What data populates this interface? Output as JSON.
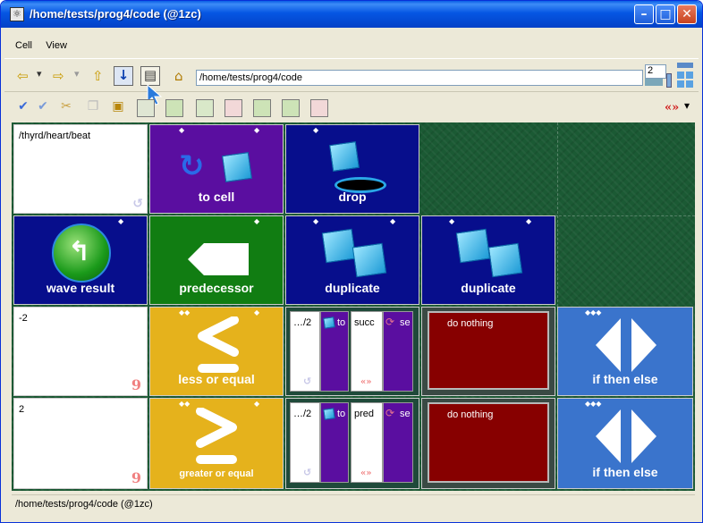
{
  "window": {
    "title": "/home/tests/prog4/code (@1zc)",
    "title_icon_glyph": "⚛",
    "minimize_glyph": "–",
    "maximize_glyph": "□",
    "close_glyph": "✕"
  },
  "menu": {
    "items": [
      "Cell",
      "View"
    ]
  },
  "toolbar": {
    "path": "/home/tests/prog4/code",
    "zoom": "2",
    "back_glyph": "⇦",
    "forward_glyph": "⇨",
    "up_glyph": "⇧",
    "down_glyph": "↓",
    "home_glyph": "⌂",
    "properties_glyph": "▤",
    "dropdown_glyph": "▾",
    "quote_glyph": "«»"
  },
  "grid": {
    "row1": {
      "note": "/thyrd/heart/beat",
      "to_cell": "to cell",
      "drop": "drop"
    },
    "row2": {
      "wave_result": "wave result",
      "predecessor": "predecessor",
      "duplicate_1": "duplicate",
      "duplicate_2": "duplicate"
    },
    "row3": {
      "value": "-2",
      "compare": "less or equal",
      "sub_path": "…/2",
      "sub_to": "to",
      "sub_word": "succ",
      "sub_se": "se",
      "action": "do nothing",
      "branch": "if then else"
    },
    "row4": {
      "value": "2",
      "compare": "greater or equal",
      "sub_path": "…/2",
      "sub_to": "to",
      "sub_word": "pred",
      "sub_se": "se",
      "action": "do nothing",
      "branch": "if then else"
    }
  },
  "status": {
    "text": "/home/tests/prog4/code (@1zc)"
  },
  "colors": {
    "purple": "#5a0ea0",
    "navy": "#070e8c",
    "green": "#117d12",
    "gold": "#e5b21c",
    "maroon": "#870000",
    "blue": "#3a74cc"
  }
}
